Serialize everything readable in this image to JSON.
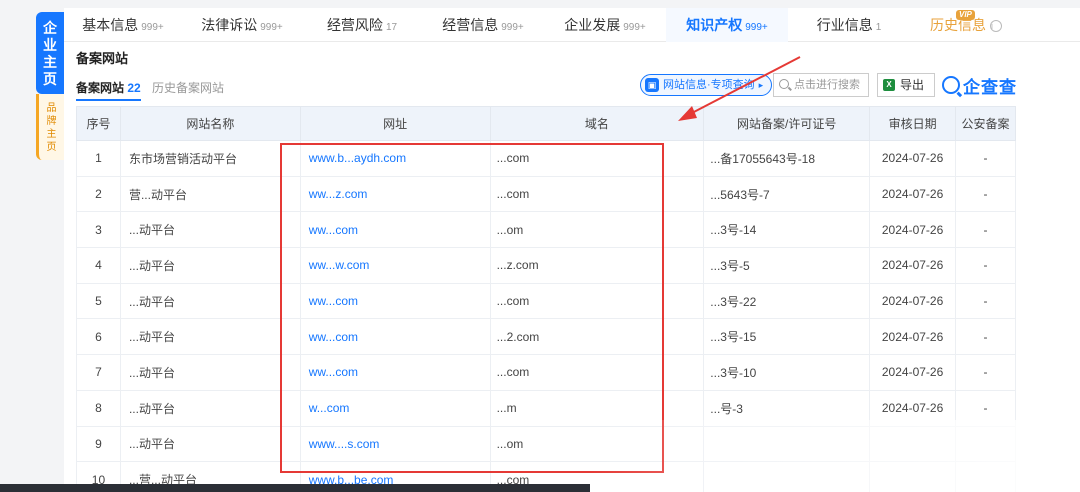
{
  "sidebar": {
    "main_label": "企业主页",
    "brand_label": "品牌主页"
  },
  "tabs": [
    {
      "label": "基本信息",
      "count": "999+"
    },
    {
      "label": "法律诉讼",
      "count": "999+"
    },
    {
      "label": "经营风险",
      "count": "17"
    },
    {
      "label": "经营信息",
      "count": "999+"
    },
    {
      "label": "企业发展",
      "count": "999+"
    },
    {
      "label": "知识产权",
      "count": "999+",
      "active": true
    },
    {
      "label": "行业信息",
      "count": "1"
    },
    {
      "label": "历史信息",
      "badge": "VIP"
    }
  ],
  "section": {
    "title": "备案网站",
    "subtab_active": "备案网站",
    "subtab_active_count": "22",
    "subtab_inactive": "历史备案网站"
  },
  "toolbar": {
    "site_info_button": "网站信息·专项查询",
    "search_placeholder": "点击进行搜索",
    "export_label": "导出",
    "logo_text": "企查查"
  },
  "table": {
    "headers": [
      "序号",
      "网站名称",
      "网址",
      "域名",
      "网站备案/许可证号",
      "审核日期",
      "公安备案"
    ],
    "rows": [
      {
        "index": "1",
        "name": "东市场营销活动平台",
        "url": "www.b...aydh.com",
        "domain": "...com",
        "license": "...备17055643号-18",
        "date": "2024-07-26",
        "police": "-"
      },
      {
        "index": "2",
        "name": "营...动平台",
        "url": "ww...z.com",
        "domain": "...com",
        "license": "...5643号-7",
        "date": "2024-07-26",
        "police": "-"
      },
      {
        "index": "3",
        "name": "...动平台",
        "url": "ww...com",
        "domain": "...om",
        "license": "...3号-14",
        "date": "2024-07-26",
        "police": "-"
      },
      {
        "index": "4",
        "name": "...动平台",
        "url": "ww...w.com",
        "domain": "...z.com",
        "license": "...3号-5",
        "date": "2024-07-26",
        "police": "-"
      },
      {
        "index": "5",
        "name": "...动平台",
        "url": "ww...com",
        "domain": "...com",
        "license": "...3号-22",
        "date": "2024-07-26",
        "police": "-"
      },
      {
        "index": "6",
        "name": "...动平台",
        "url": "ww...com",
        "domain": "...2.com",
        "license": "...3号-15",
        "date": "2024-07-26",
        "police": "-"
      },
      {
        "index": "7",
        "name": "...动平台",
        "url": "ww...com",
        "domain": "...com",
        "license": "...3号-10",
        "date": "2024-07-26",
        "police": "-"
      },
      {
        "index": "8",
        "name": "...动平台",
        "url": "w...com",
        "domain": "...m",
        "license": "...号-3",
        "date": "2024-07-26",
        "police": "-"
      },
      {
        "index": "9",
        "name": "...动平台",
        "url": "www....s.com",
        "domain": "...om",
        "license": "",
        "date": "",
        "police": ""
      },
      {
        "index": "10",
        "name": "...营...动平台",
        "url": "www.b...be.com",
        "domain": "...com",
        "license": "",
        "date": "",
        "police": ""
      }
    ]
  },
  "colors": {
    "accent": "#1677ff",
    "annotation": "#e53935",
    "vip": "#e8a23b"
  }
}
